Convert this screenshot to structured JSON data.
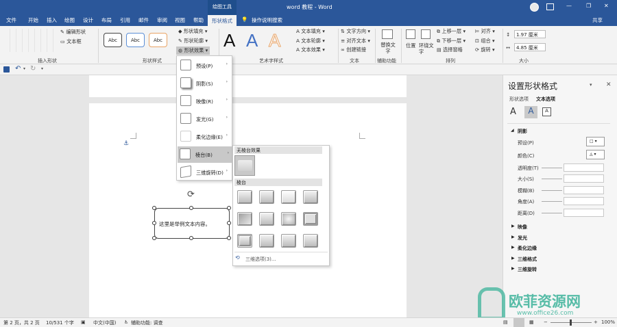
{
  "window": {
    "title": "word 教程 - Word",
    "drawing_tools": "绘图工具",
    "user_icon": "user-avatar-icon",
    "minimize": "—",
    "restore": "❐",
    "close": "✕",
    "share": "共享"
  },
  "tabs": [
    "文件",
    "开始",
    "插入",
    "绘图",
    "设计",
    "布局",
    "引用",
    "邮件",
    "审阅",
    "视图",
    "帮助",
    "形状格式"
  ],
  "tell_me": "操作说明搜索",
  "ribbon": {
    "insert_shapes": {
      "edit_shape": "编辑形状",
      "text_box": "文本框",
      "label": "插入形状"
    },
    "shape_styles": {
      "abc": [
        "Abc",
        "Abc",
        "Abc"
      ],
      "fill": "形状填充",
      "outline": "形状轮廓",
      "effects": "形状效果",
      "label": "形状样式"
    },
    "wordart": {
      "letters": [
        "A",
        "A",
        "A"
      ],
      "text_fill": "文本填充",
      "text_outline": "文本轮廓",
      "text_effects": "文本效果",
      "label": "艺术字样式"
    },
    "text": {
      "direction": "文字方向",
      "align": "对齐文本",
      "link": "创建链接",
      "label": "文本"
    },
    "accessibility": {
      "alt_text": "替换文字",
      "label": "辅助功能"
    },
    "arrange": {
      "position": "位置",
      "wrap": "环绕文字",
      "forward": "上移一层",
      "backward": "下移一层",
      "selection_pane": "选择窗格",
      "align": "对齐",
      "group": "组合",
      "rotate": "旋转",
      "label": "排列"
    },
    "size": {
      "height": "1.97 厘米",
      "width": "4.85 厘米",
      "label": "大小"
    }
  },
  "effects_menu": {
    "items": [
      {
        "label": "预设(P)"
      },
      {
        "label": "阴影(S)"
      },
      {
        "label": "映像(R)"
      },
      {
        "label": "发光(G)"
      },
      {
        "label": "柔化边缘(E)"
      },
      {
        "label": "棱台(B)"
      },
      {
        "label": "三维旋转(D)"
      }
    ]
  },
  "bevel_submenu": {
    "no_bevel_header": "无棱台效果",
    "bevel_header": "棱台",
    "options": "三维选项(3)..."
  },
  "document": {
    "shape_text": "这里是举例文本内容。"
  },
  "pane": {
    "title": "设置形状格式",
    "tab_shape": "形状选项",
    "tab_text": "文本选项",
    "section_shadow": "阴影",
    "props": [
      "预设(P)",
      "颜色(C)",
      "透明度(T)",
      "大小(S)",
      "模糊(B)",
      "角度(A)",
      "距离(D)"
    ],
    "collapsed_sections": [
      "映像",
      "发光",
      "柔化边缘",
      "三维格式",
      "三维旋转"
    ]
  },
  "status": {
    "page": "第 2 页，共 2 页",
    "words": "10/531 个字",
    "language": "中文(中国)",
    "accessibility": "辅助功能: 调查",
    "zoom": "100%"
  },
  "watermark": {
    "cn": "欧菲资源网",
    "url": "www.office26.com"
  },
  "colors": {
    "brand": "#2b579a",
    "accent_orange": "#e8a365",
    "watermark_green": "#3cb39a"
  }
}
